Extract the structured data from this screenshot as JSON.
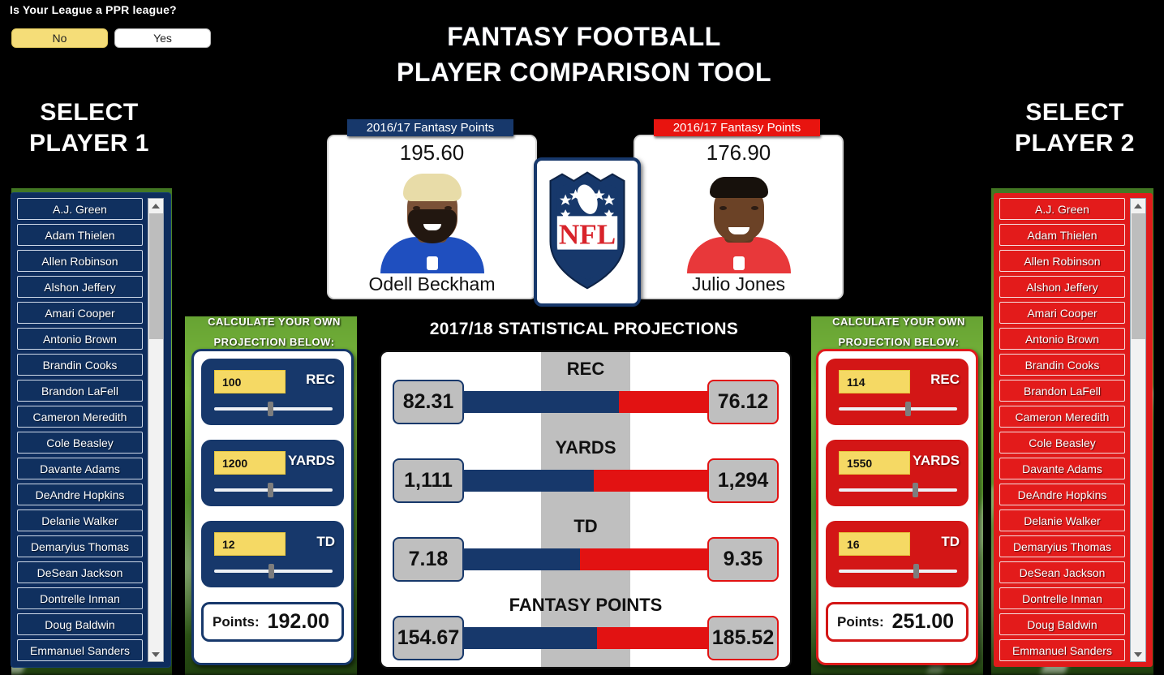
{
  "ppr": {
    "question": "Is Your League a PPR league?",
    "options": [
      "No",
      "Yes"
    ],
    "selected": "No"
  },
  "header": {
    "title_line1": "FANTASY FOOTBALL",
    "title_line2": "PLAYER COMPARISON TOOL"
  },
  "left_panel": {
    "select_heading_line1": "SELECT",
    "select_heading_line2": "PLAYER 1",
    "accent_color": "#17386b"
  },
  "right_panel": {
    "select_heading_line1": "SELECT",
    "select_heading_line2": "PLAYER 2",
    "accent_color": "#e01b1b"
  },
  "player_list": [
    "A.J. Green",
    "Adam Thielen",
    "Allen Robinson",
    "Alshon Jeffery",
    "Amari Cooper",
    "Antonio Brown",
    "Brandin Cooks",
    "Brandon LaFell",
    "Cameron Meredith",
    "Cole Beasley",
    "Davante Adams",
    "DeAndre Hopkins",
    "Delanie Walker",
    "Demaryius Thomas",
    "DeSean Jackson",
    "Dontrelle Inman",
    "Doug Baldwin",
    "Emmanuel Sanders"
  ],
  "player1_card": {
    "badge": "2016/17 Fantasy Points",
    "points": "195.60",
    "name": "Odell Beckham",
    "jersey_color": "#1f4fbf",
    "hair_color": "#e8dca8",
    "skin_color": "#7a5137"
  },
  "player2_card": {
    "badge": "2016/17 Fantasy Points",
    "points": "176.90",
    "name": "Julio Jones",
    "jersey_color": "#e8383a",
    "hair_color": "#17110c",
    "skin_color": "#6b4226"
  },
  "center_logo": {
    "name": "NFL",
    "letters": "NFL"
  },
  "calc_left": {
    "title_line1": "CALCULATE YOUR OWN",
    "title_line2": "PROJECTION BELOW:",
    "stats": [
      {
        "label": "REC",
        "value": "100",
        "slider_pct": 45
      },
      {
        "label": "YARDS",
        "value": "1200",
        "slider_pct": 45
      },
      {
        "label": "TD",
        "value": "12",
        "slider_pct": 46
      }
    ],
    "points_label": "Points:",
    "points_value": "192.00"
  },
  "calc_right": {
    "title_line1": "CALCULATE YOUR OWN",
    "title_line2": "PROJECTION BELOW:",
    "stats": [
      {
        "label": "REC",
        "value": "114",
        "slider_pct": 56
      },
      {
        "label": "YARDS",
        "value": "1550",
        "slider_pct": 62
      },
      {
        "label": "TD",
        "value": "16",
        "slider_pct": 63
      }
    ],
    "points_label": "Points:",
    "points_value": "251.00"
  },
  "projections": {
    "title": "2017/18 STATISTICAL PROJECTIONS",
    "rows": [
      {
        "category": "REC",
        "left": "82.31",
        "right": "76.12",
        "split_pct": 62
      },
      {
        "category": "YARDS",
        "left": "1,111",
        "right": "1,294",
        "split_pct": 53
      },
      {
        "category": "TD",
        "left": "7.18",
        "right": "9.35",
        "split_pct": 48
      },
      {
        "category": "FANTASY POINTS",
        "left": "154.67",
        "right": "185.52",
        "split_pct": 54
      }
    ]
  },
  "chart_data": {
    "type": "bar",
    "title": "2017/18 STATISTICAL PROJECTIONS",
    "categories": [
      "REC",
      "YARDS",
      "TD",
      "FANTASY POINTS"
    ],
    "series": [
      {
        "name": "Odell Beckham",
        "color": "#17386b",
        "values": [
          82.31,
          1111,
          7.18,
          154.67
        ]
      },
      {
        "name": "Julio Jones",
        "color": "#e21212",
        "values": [
          76.12,
          1294,
          9.35,
          185.52
        ]
      }
    ],
    "legend": "none",
    "grid": false
  }
}
